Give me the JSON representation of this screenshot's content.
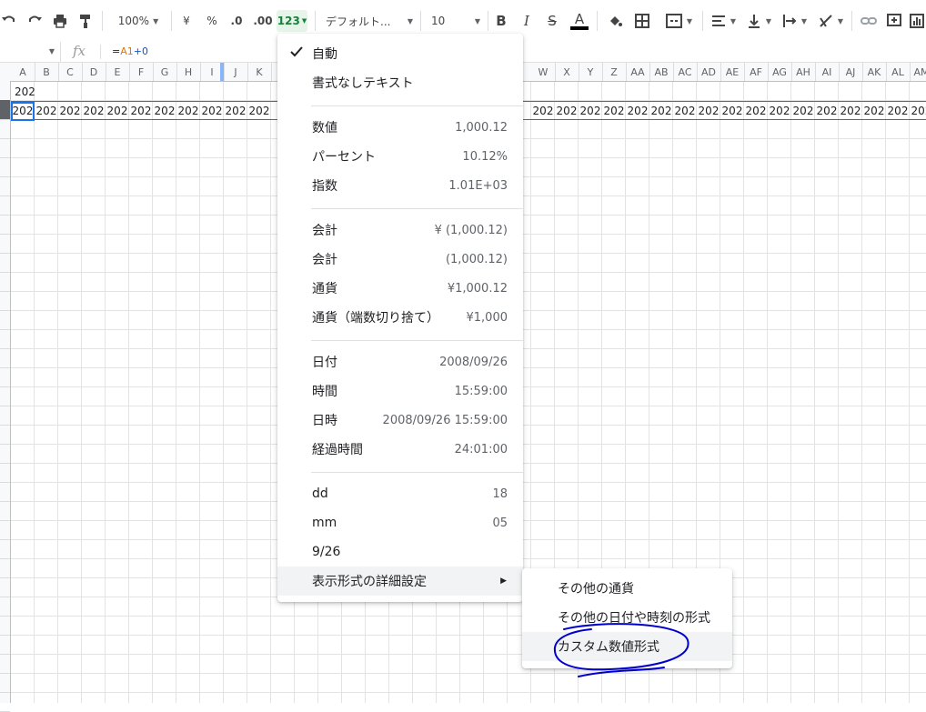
{
  "toolbar": {
    "zoom": "100%",
    "currency_symbol": "¥",
    "percent_symbol": "%",
    "decrease_decimal": ".0",
    "increase_decimal": ".00",
    "more_formats": "123",
    "font": "デフォルト...",
    "font_size": "10",
    "bold": "B",
    "italic": "I",
    "strike": "S",
    "text_color": "A"
  },
  "formula_bar": {
    "fx": "fx",
    "eq": "=",
    "ref": "A1",
    "op": "+0"
  },
  "columns": [
    "A",
    "B",
    "C",
    "D",
    "E",
    "F",
    "G",
    "H",
    "I",
    "J",
    "K",
    "W",
    "X",
    "Y",
    "Z",
    "AA",
    "AB",
    "AC",
    "AD",
    "AE",
    "AF",
    "AG",
    "AH",
    "AI",
    "AJ",
    "AK",
    "AL",
    "AM"
  ],
  "cells": {
    "a1": "202",
    "row2_value": "202"
  },
  "menu": {
    "auto": "自動",
    "plain_text": "書式なしテキスト",
    "number": {
      "label": "数値",
      "value": "1,000.12"
    },
    "percent": {
      "label": "パーセント",
      "value": "10.12%"
    },
    "scientific": {
      "label": "指数",
      "value": "1.01E+03"
    },
    "accounting": {
      "label": "会計",
      "value": "¥ (1,000.12)"
    },
    "financial": {
      "label": "会計",
      "value": "(1,000.12)"
    },
    "currency": {
      "label": "通貨",
      "value": "¥1,000.12"
    },
    "currency_rounded": {
      "label": "通貨（端数切り捨て）",
      "value": "¥1,000"
    },
    "date": {
      "label": "日付",
      "value": "2008/09/26"
    },
    "time": {
      "label": "時間",
      "value": "15:59:00"
    },
    "datetime": {
      "label": "日時",
      "value": "2008/09/26 15:59:00"
    },
    "duration": {
      "label": "経過時間",
      "value": "24:01:00"
    },
    "dd": {
      "label": "dd",
      "value": "18"
    },
    "mm": {
      "label": "mm",
      "value": "05"
    },
    "md": {
      "label": "9/26"
    },
    "more_formats": "表示形式の詳細設定"
  },
  "submenu": {
    "more_currencies": "その他の通貨",
    "more_datetime": "その他の日付や時刻の形式",
    "custom_number": "カスタム数値形式"
  },
  "colors": {
    "accent": "#1a73e8",
    "annotation": "#0000cc"
  }
}
